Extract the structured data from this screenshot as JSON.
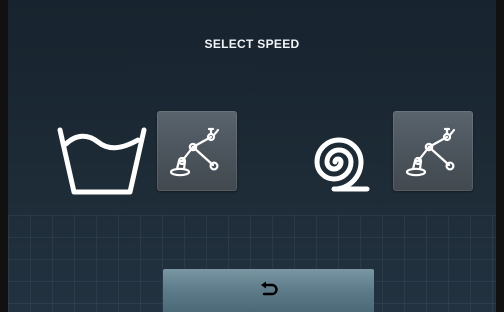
{
  "screen": {
    "title": "SELECT SPEED"
  },
  "options": [
    {
      "icon": "wash-tub-icon",
      "button_icon": "robot-arm-icon"
    },
    {
      "icon": "spiral-spin-icon",
      "button_icon": "robot-arm-icon"
    }
  ],
  "footer": {
    "back_icon": "return-arrow-icon"
  },
  "colors": {
    "background": "#1d2b36",
    "icon_white": "#ffffff",
    "button_gray": "#4d565e",
    "back_button": "#5d7b89"
  }
}
